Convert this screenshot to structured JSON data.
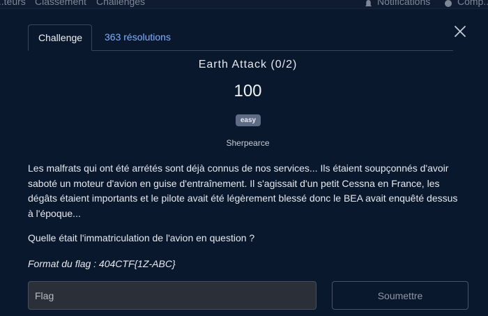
{
  "navbar": {
    "items": [
      "...teurs",
      "Classement",
      "Challenges"
    ],
    "notifications_label": "Notifications",
    "account_label": "Comp..."
  },
  "tabs": [
    {
      "label": "Challenge",
      "active": true
    },
    {
      "label": "363 résolutions",
      "active": false
    }
  ],
  "challenge": {
    "title": "Earth Attack (0/2)",
    "points": "100",
    "difficulty": "easy",
    "author": "Sherpearce",
    "description": "Les malfrats qui ont été arrétés sont déjà connus de nos services... Ils étaient soupçonnés d'avoir saboté un moteur d'avion en guise d'entraînement. Il s'agissait d'un petit Cessna en France, les dégâts étaient importants et le pilote avait été légèrement blessé donc le BEA avait enquêté dessus à l'époque...",
    "question": "Quelle était l'immatriculation de l'avion en question ?",
    "flag_format": "Format du flag : 404CTF{1Z-ABC}"
  },
  "form": {
    "flag_placeholder": "Flag",
    "flag_value": "",
    "submit_label": "Soumettre"
  },
  "colors": {
    "background": "#0a182e",
    "link": "#7fb2ff",
    "badge": "#5d6b85"
  },
  "icons": [
    "bell-icon",
    "user-icon",
    "close-icon"
  ]
}
